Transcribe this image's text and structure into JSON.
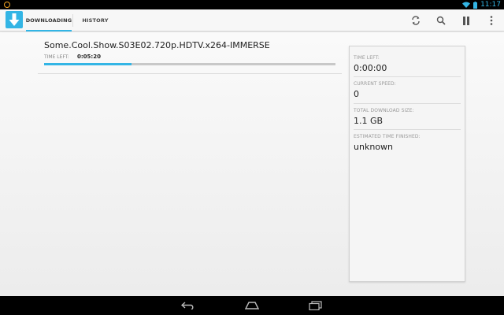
{
  "status_bar": {
    "time": "11:17",
    "accent_color": "#33b5e5"
  },
  "action_bar": {
    "app_icon": "download-arrow-icon",
    "tabs": [
      {
        "label": "DOWNLOADING",
        "active": true
      },
      {
        "label": "HISTORY",
        "active": false
      }
    ],
    "actions": [
      "refresh-icon",
      "search-icon",
      "pause-icon",
      "overflow-menu-icon"
    ]
  },
  "download": {
    "name": "Some.Cool.Show.S03E02.720p.HDTV.x264-IMMERSE",
    "time_left_label": "TIME LEFT:",
    "time_left_value": "0:05:20",
    "progress_fraction": 0.3
  },
  "panel": {
    "stats": [
      {
        "label": "TIME LEFT:",
        "value": "0:00:00"
      },
      {
        "label": "CURRENT SPEED:",
        "value": "0"
      },
      {
        "label": "TOTAL DOWNLOAD SIZE:",
        "value": "1.1 GB"
      },
      {
        "label": "ESTIMATED TIME FINISHED:",
        "value": "unknown"
      }
    ]
  },
  "nav_bar": {
    "buttons": [
      "back-icon",
      "home-icon",
      "recent-apps-icon"
    ]
  }
}
